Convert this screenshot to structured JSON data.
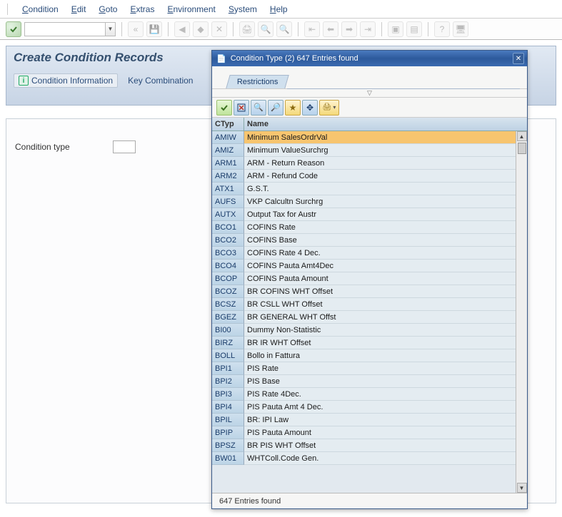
{
  "menu": {
    "items": [
      {
        "hot": "C",
        "rest": "ondition"
      },
      {
        "hot": "E",
        "rest": "dit"
      },
      {
        "hot": "G",
        "rest": "oto"
      },
      {
        "hot": "E",
        "rest": "xtras"
      },
      {
        "hot": "E",
        "rest": "nvironment"
      },
      {
        "hot": "S",
        "rest": "ystem"
      },
      {
        "hot": "H",
        "rest": "elp"
      }
    ]
  },
  "main": {
    "title": "Create Condition Records",
    "info_btn": "Condition Information",
    "keycomb_btn": "Key Combination",
    "label_condtype": "Condition type"
  },
  "popup": {
    "doc_icon": "📄",
    "title": "Condition Type (2)  647 Entries found",
    "tab": "Restrictions",
    "header_ctyp": "CTyp",
    "header_name": "Name",
    "status": "647 Entries found",
    "rows": [
      {
        "c": "AMIW",
        "n": "Minimum SalesOrdrVal",
        "sel": true
      },
      {
        "c": "AMIZ",
        "n": "Minimum ValueSurchrg"
      },
      {
        "c": "ARM1",
        "n": "ARM - Return Reason"
      },
      {
        "c": "ARM2",
        "n": "ARM - Refund Code"
      },
      {
        "c": "ATX1",
        "n": "G.S.T."
      },
      {
        "c": "AUFS",
        "n": "VKP Calcultn Surchrg"
      },
      {
        "c": "AUTX",
        "n": "Output Tax for Austr"
      },
      {
        "c": "BCO1",
        "n": "COFINS Rate"
      },
      {
        "c": "BCO2",
        "n": "COFINS Base"
      },
      {
        "c": "BCO3",
        "n": "COFINS Rate 4 Dec."
      },
      {
        "c": "BCO4",
        "n": "COFINS Pauta Amt4Dec"
      },
      {
        "c": "BCOP",
        "n": "COFINS Pauta Amount"
      },
      {
        "c": "BCOZ",
        "n": "BR COFINS WHT Offset"
      },
      {
        "c": "BCSZ",
        "n": "BR CSLL WHT Offset"
      },
      {
        "c": "BGEZ",
        "n": "BR GENERAL WHT Offst"
      },
      {
        "c": "BI00",
        "n": "Dummy Non-Statistic"
      },
      {
        "c": "BIRZ",
        "n": "BR IR WHT Offset"
      },
      {
        "c": "BOLL",
        "n": "Bollo in Fattura"
      },
      {
        "c": "BPI1",
        "n": "PIS Rate"
      },
      {
        "c": "BPI2",
        "n": "PIS Base"
      },
      {
        "c": "BPI3",
        "n": "PIS Rate 4Dec."
      },
      {
        "c": "BPI4",
        "n": "PIS Pauta Amt 4 Dec."
      },
      {
        "c": "BPIL",
        "n": "BR: IPI Law"
      },
      {
        "c": "BPIP",
        "n": "PIS Pauta Amount"
      },
      {
        "c": "BPSZ",
        "n": "BR PIS WHT Offset"
      },
      {
        "c": "BW01",
        "n": "WHTColl.Code Gen."
      }
    ]
  }
}
